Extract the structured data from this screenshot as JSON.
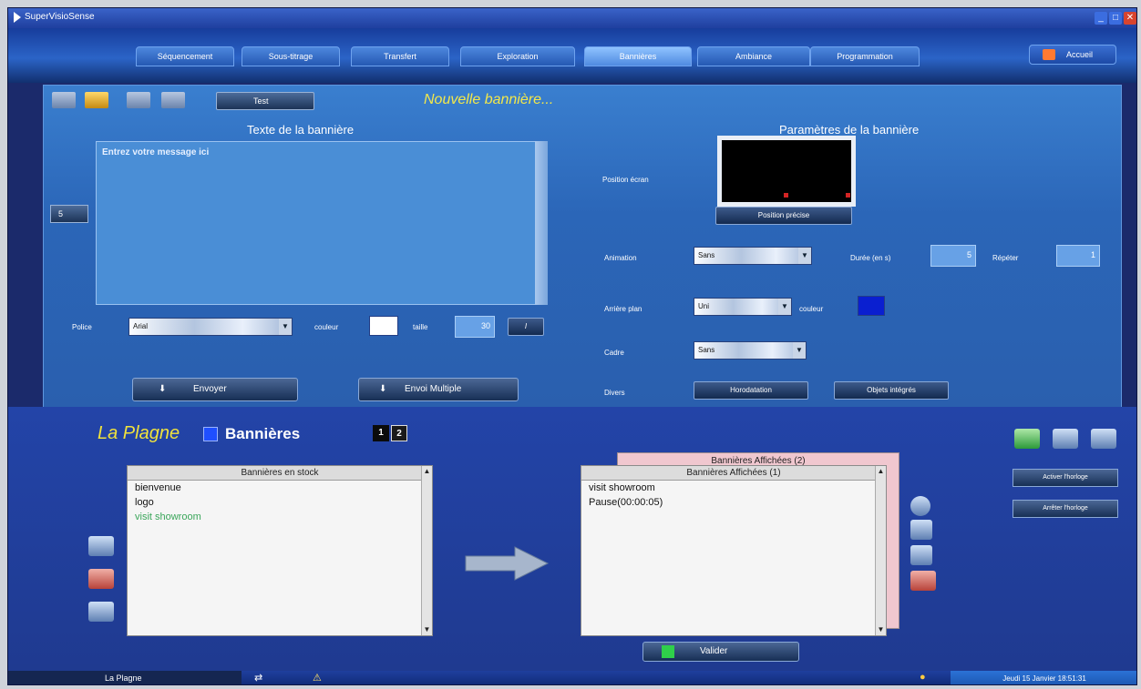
{
  "window": {
    "title": "SuperVisioSense"
  },
  "tabs": [
    {
      "label": "Séquencement"
    },
    {
      "label": "Sous-titrage"
    },
    {
      "label": "Transfert"
    },
    {
      "label": "Exploration"
    },
    {
      "label": "Bannières"
    },
    {
      "label": "Ambiance"
    },
    {
      "label": "Programmation"
    }
  ],
  "accueil_label": "Accueil",
  "editor": {
    "test_label": "Test",
    "status": "Nouvelle bannière...",
    "text_heading": "Texte de la bannière",
    "message": "Entrez votre message ici",
    "side_button": "5",
    "font_label": "Police",
    "font_value": "Arial",
    "color_label": "couleur",
    "size_label": "taille",
    "size_value": "30",
    "italic_label": "I",
    "send_label": "Envoyer",
    "send_multi_label": "Envoi Multiple"
  },
  "params": {
    "heading": "Paramètres de la bannière",
    "position_label": "Position écran",
    "precise_label": "Position précise",
    "animation_label": "Animation",
    "animation_value": "Sans",
    "duration_label": "Durée (en s)",
    "duration_value": "5",
    "repeat_label": "Répéter",
    "repeat_value": "1",
    "background_label": "Arrière plan",
    "background_value": "Uni",
    "bg_color_label": "couleur",
    "frame_label": "Cadre",
    "frame_value": "Sans",
    "misc_label": "Divers",
    "misc_btn1": "Horodatation",
    "misc_btn2": "Objets intégrés",
    "colors": {
      "text": "#ffffff",
      "background": "#0a1fd0"
    }
  },
  "bottom": {
    "site": "La Plagne",
    "section": "Bannières",
    "pages": [
      "1",
      "2"
    ],
    "stock_header": "Bannières en stock",
    "stock_items": [
      {
        "label": "bienvenue",
        "color": "#111111"
      },
      {
        "label": "logo",
        "color": "#111111"
      },
      {
        "label": "visit showroom",
        "color": "#3aa65a"
      }
    ],
    "displayed2_header": "Bannières Affichées (2)",
    "displayed1_header": "Bannières Affichées (1)",
    "displayed_items": [
      "visit showroom",
      "Pause(00:00:05)"
    ],
    "valider_label": "Valider",
    "clock_on": "Activer l'horloge",
    "clock_off": "Arrêter l'horloge"
  },
  "statusbar": {
    "site": "La Plagne",
    "datetime": "Jeudi 15 Janvier 18:51:31"
  }
}
